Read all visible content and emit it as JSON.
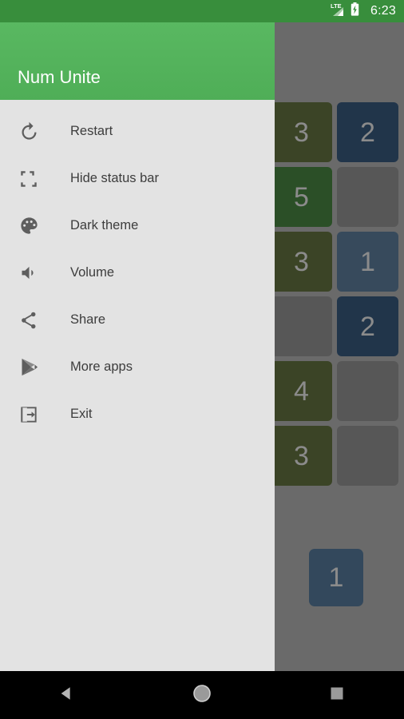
{
  "status_bar": {
    "network_label": "LTE",
    "signal_icon": "signal-bars-icon",
    "battery_icon": "battery-charging-icon",
    "clock": "6:23",
    "background_color": "#388e3c"
  },
  "drawer": {
    "app_title": "Num Unite",
    "header_color": "#55b55c",
    "background_color": "#e3e3e3",
    "items": [
      {
        "label": "Restart",
        "icon": "restart-icon"
      },
      {
        "label": "Hide status bar",
        "icon": "fullscreen-icon"
      },
      {
        "label": "Dark theme",
        "icon": "palette-icon"
      },
      {
        "label": "Volume",
        "icon": "volume-icon"
      },
      {
        "label": "Share",
        "icon": "share-icon"
      },
      {
        "label": "More apps",
        "icon": "play-store-icon"
      },
      {
        "label": "Exit",
        "icon": "exit-icon"
      }
    ]
  },
  "game": {
    "scrim_color": "#6a6a6a",
    "tile_colors": {
      "olive": "#3b4426",
      "green": "#2b4f27",
      "navy": "#21354a",
      "slate": "#374a5c",
      "empty": "#575757"
    },
    "grid": {
      "columns": 6,
      "rows": 6,
      "cells": [
        [
          "",
          "",
          "",
          "",
          "3",
          "2"
        ],
        [
          "",
          "",
          "",
          "",
          "5",
          ""
        ],
        [
          "",
          "",
          "",
          "",
          "3",
          "1"
        ],
        [
          "",
          "",
          "",
          "",
          "",
          "2"
        ],
        [
          "",
          "",
          "",
          "",
          "4",
          ""
        ],
        [
          "",
          "",
          "",
          "",
          "3",
          ""
        ]
      ],
      "cell_styles": [
        [
          "hidden",
          "hidden",
          "hidden",
          "hidden",
          "olive",
          "navy"
        ],
        [
          "hidden",
          "hidden",
          "hidden",
          "hidden",
          "green",
          "empty"
        ],
        [
          "hidden",
          "hidden",
          "hidden",
          "hidden",
          "olive",
          "slate"
        ],
        [
          "hidden",
          "hidden",
          "hidden",
          "hidden",
          "empty",
          "navy"
        ],
        [
          "hidden",
          "hidden",
          "hidden",
          "hidden",
          "olive",
          "empty"
        ],
        [
          "hidden",
          "hidden",
          "hidden",
          "hidden",
          "olive",
          "empty"
        ]
      ]
    },
    "floating_tile": {
      "value": "1",
      "color": "#33485c"
    }
  },
  "nav_bar": {
    "back_icon": "back-triangle-icon",
    "home_icon": "home-circle-icon",
    "recents_icon": "recents-square-icon"
  }
}
